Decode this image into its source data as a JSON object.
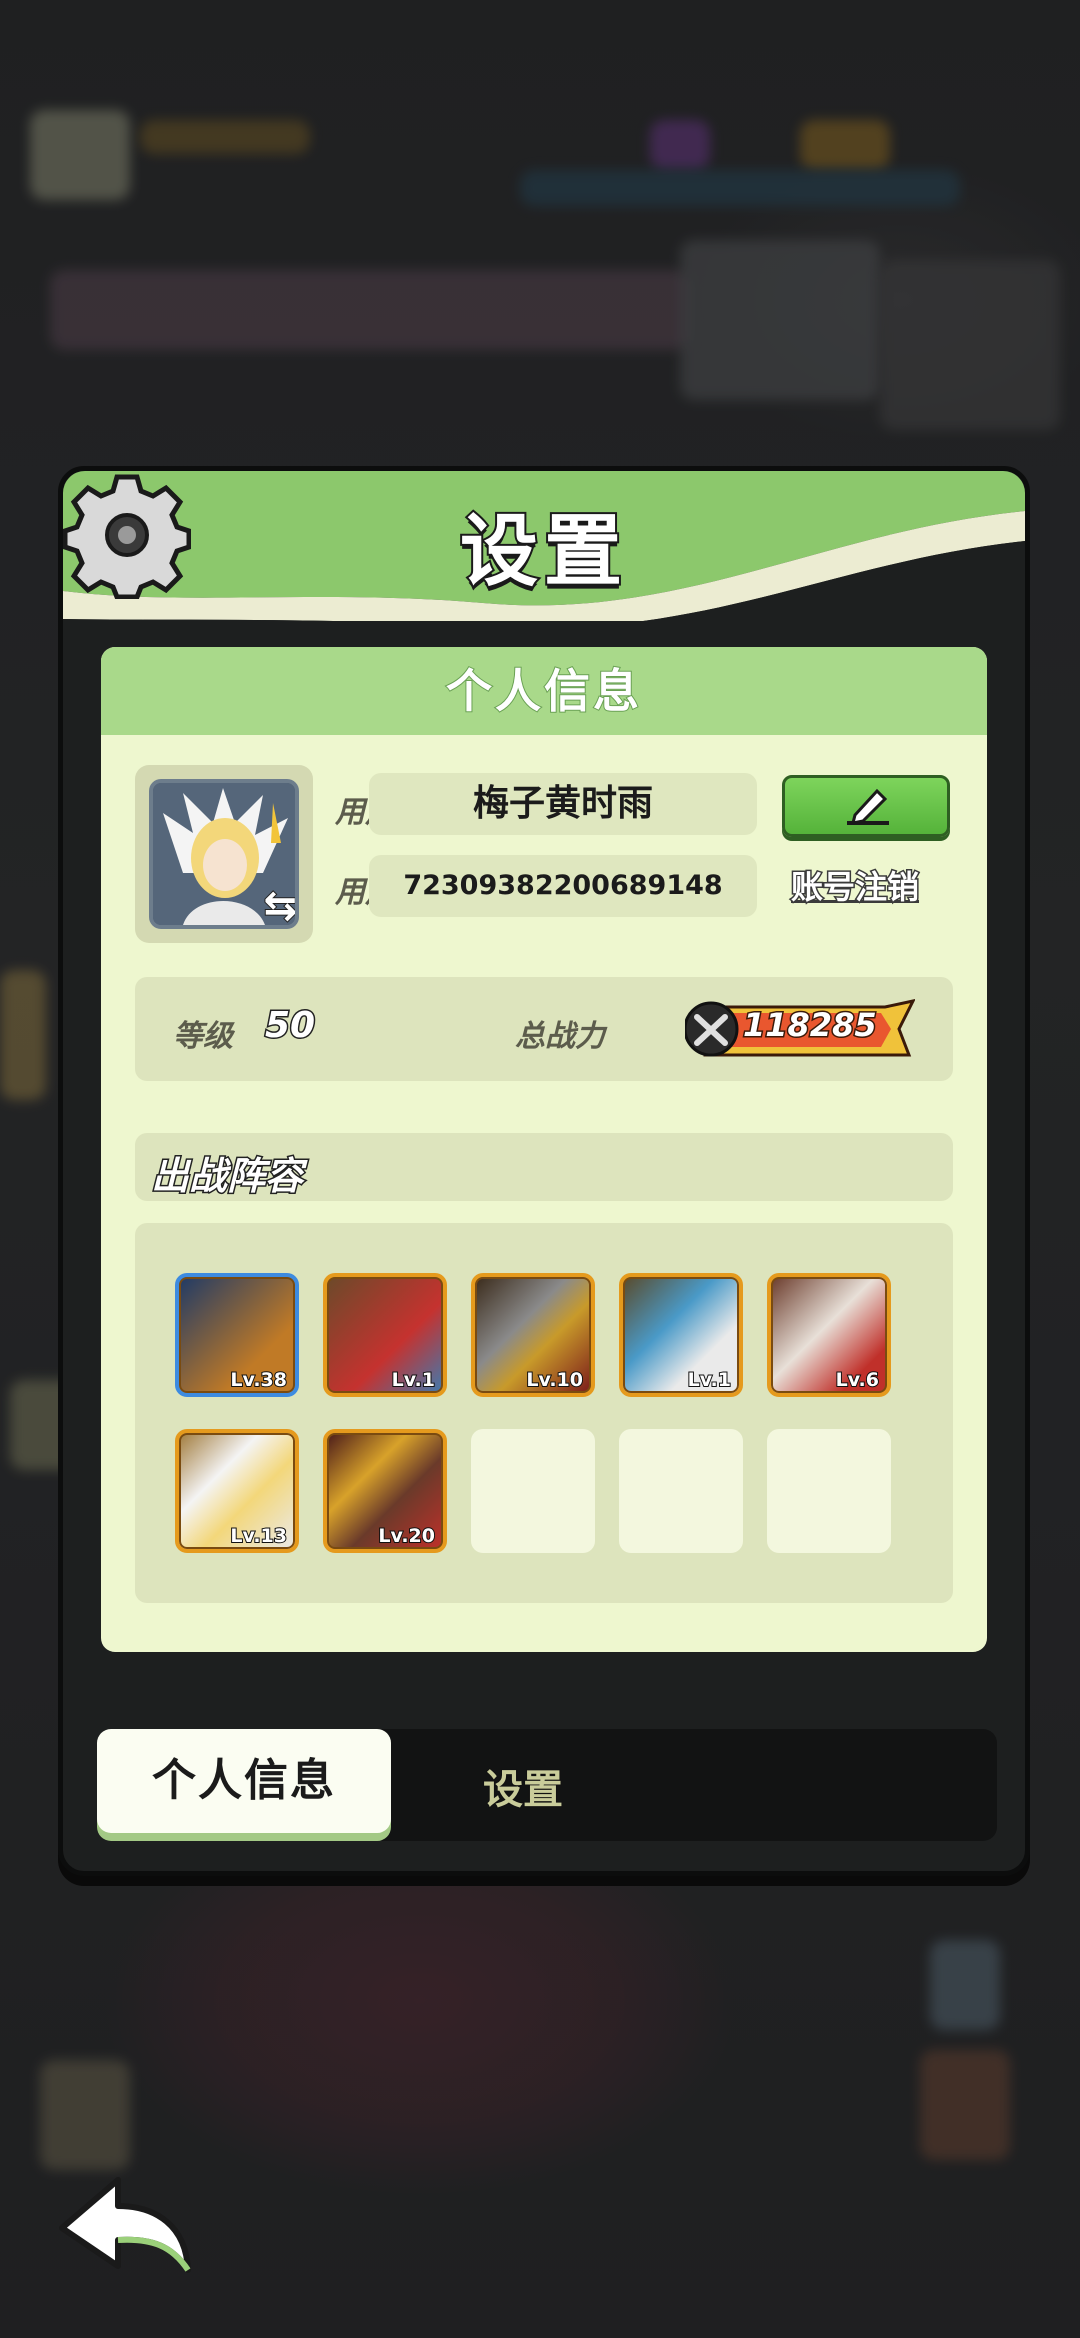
{
  "dialog": {
    "title": "设置",
    "gear_icon": "gear-icon"
  },
  "profile": {
    "section_title": "个人信息",
    "nickname_label": "用户昵称",
    "nickname": "梅子黄时雨",
    "id_label": "用户  ID",
    "user_id": "72309382200689148",
    "delete_account": "账号注销",
    "edit_icon": "pencil-icon"
  },
  "stats": {
    "level_label": "等级",
    "level": "50",
    "power_label": "总战力",
    "power": "118285"
  },
  "lineup": {
    "title": "出战阵容",
    "heroes": [
      {
        "level": "Lv.38",
        "frame": "blue"
      },
      {
        "level": "Lv.1",
        "frame": "orange"
      },
      {
        "level": "Lv.10",
        "frame": "orange"
      },
      {
        "level": "Lv.1",
        "frame": "orange"
      },
      {
        "level": "Lv.6",
        "frame": "orange"
      },
      {
        "level": "Lv.13",
        "frame": "orange"
      },
      {
        "level": "Lv.20",
        "frame": "orange"
      }
    ],
    "empty_slots": 3
  },
  "tabs": {
    "active": "个人信息",
    "other": "设置"
  },
  "colors": {
    "header_green": "#a9d98a",
    "panel_bg": "#eef7cf",
    "edit_button": "#6ac84b",
    "power_badge": "#f0c23a"
  }
}
